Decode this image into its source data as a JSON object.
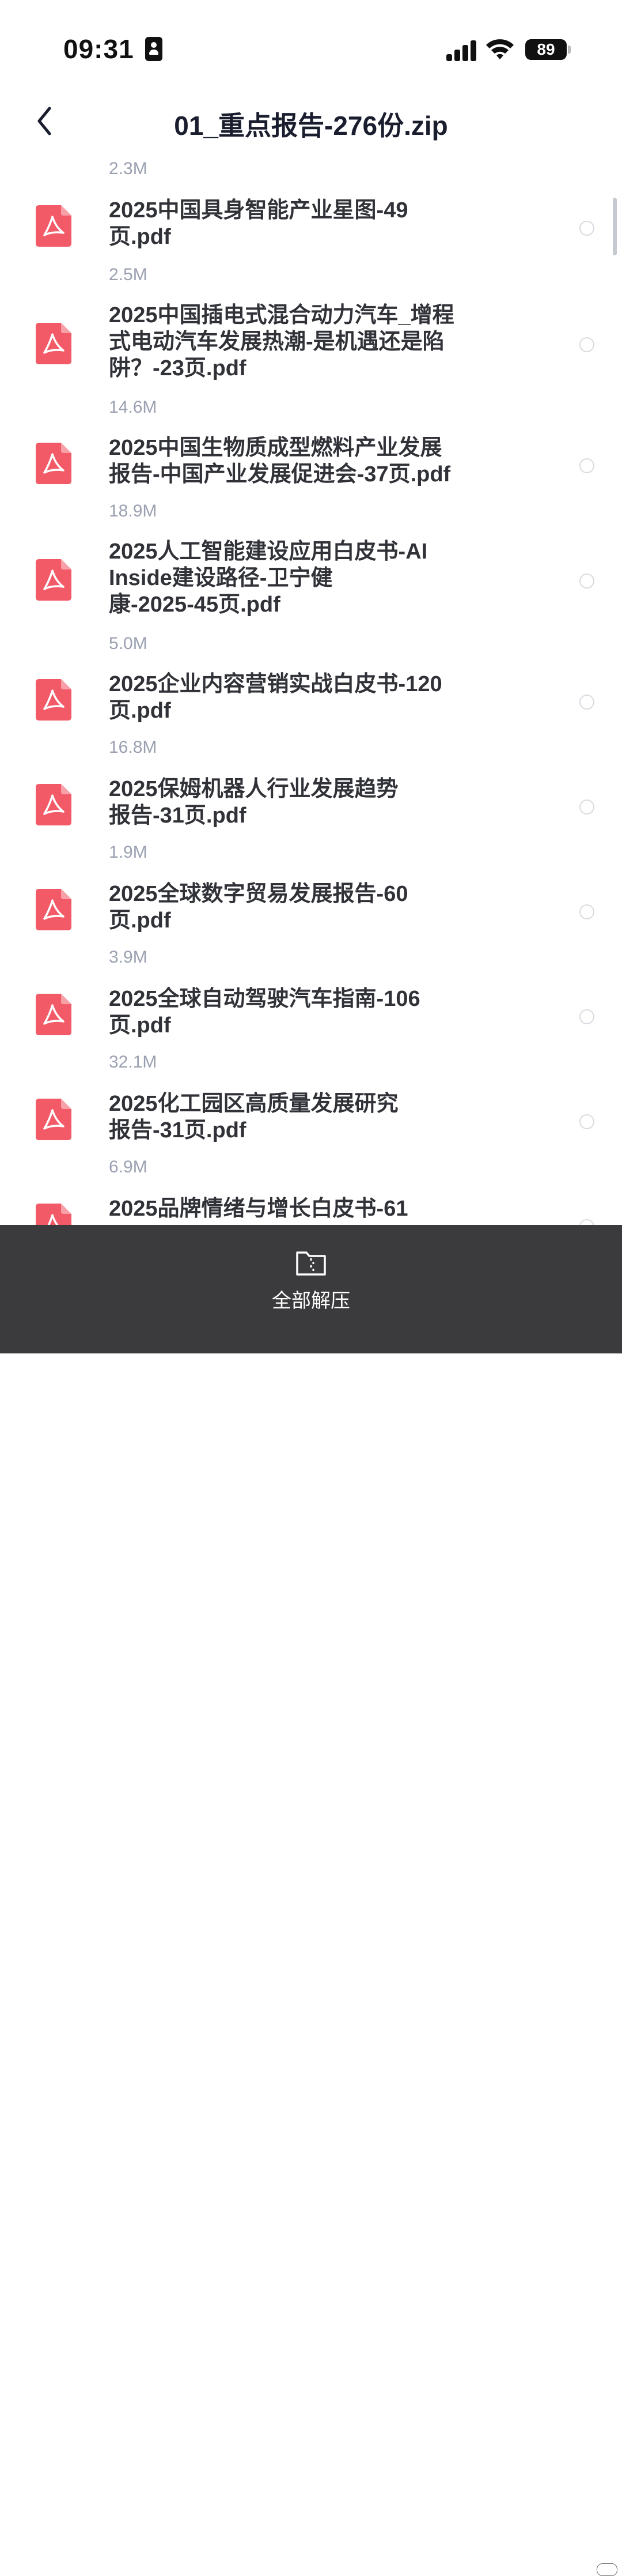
{
  "status_bar": {
    "time": "09:31",
    "battery": "89"
  },
  "header": {
    "title": "01_重点报告-276份.zip"
  },
  "files": [
    {
      "size": "2.3M"
    },
    {
      "name": "2025中国具身智能产业星图-49页.pdf",
      "lines": [
        "2025中国具身智能产业星图-49",
        "页.pdf"
      ],
      "size": "2.5M"
    },
    {
      "name": "2025中国插电式混合动力汽车_增程式电动汽车发展热潮-是机遇还是陷阱？-23页.pdf",
      "lines": [
        "2025中国插电式混合动力汽车_增程",
        "式电动汽车发展热潮-是机遇还是陷",
        "阱？-23页.pdf"
      ],
      "size": "14.6M"
    },
    {
      "name": "2025中国生物质成型燃料产业发展报告-中国产业发展促进会-37页.pdf",
      "lines": [
        "2025中国生物质成型燃料产业发展",
        "报告-中国产业发展促进会-37页.pdf"
      ],
      "size": "18.9M"
    },
    {
      "name": "2025人工智能建设应用白皮书-AI Inside建设路径-卫宁健康-2025-45页.pdf",
      "lines": [
        "2025人工智能建设应用白皮书-AI",
        "Inside建设路径-卫宁健",
        "康-2025-45页.pdf"
      ],
      "size": "5.0M"
    },
    {
      "name": "2025企业内容营销实战白皮书-120页.pdf",
      "lines": [
        "2025企业内容营销实战白皮书-120",
        "页.pdf"
      ],
      "size": "16.8M"
    },
    {
      "name": "2025保姆机器人行业发展趋势报告-31页.pdf",
      "lines": [
        "2025保姆机器人行业发展趋势",
        "报告-31页.pdf"
      ],
      "size": "1.9M"
    },
    {
      "name": "2025全球数字贸易发展报告-60页.pdf",
      "lines": [
        "2025全球数字贸易发展报告-60",
        "页.pdf"
      ],
      "size": "3.9M"
    },
    {
      "name": "2025全球自动驾驶汽车指南-106页.pdf",
      "lines": [
        "2025全球自动驾驶汽车指南-106",
        "页.pdf"
      ],
      "size": "32.1M"
    },
    {
      "name": "2025化工园区高质量发展研究报告-31页.pdf",
      "lines": [
        "2025化工园区高质量发展研究",
        "报告-31页.pdf"
      ],
      "size": "6.9M"
    },
    {
      "name": "2025品牌情绪与增长白皮书-61",
      "lines": [
        "2025品牌情绪与增长白皮书-61"
      ]
    }
  ],
  "bottom_bar": {
    "unzip_all_label": "全部解压"
  },
  "colors": {
    "pdf_icon": "#f25a68",
    "bottom_bar": "#3b3b3d",
    "title": "#1a1d2e",
    "size_text": "#9aa0b0"
  }
}
